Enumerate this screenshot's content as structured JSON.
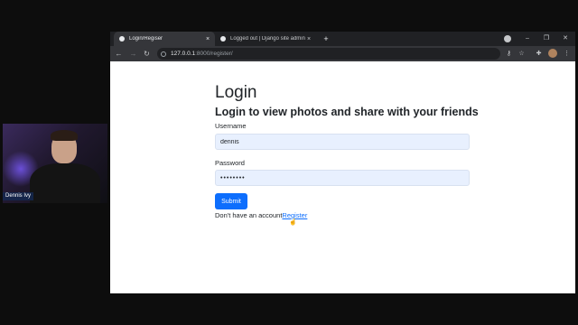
{
  "webcam": {
    "presenter_name": "Dennis Ivy"
  },
  "browser": {
    "tabs": [
      {
        "title": "Login/Regiser",
        "close": "×"
      },
      {
        "title": "Logged out | Django site admin",
        "close": "×"
      }
    ],
    "new_tab": "+",
    "window_controls": {
      "minimize": "–",
      "maximize": "❐",
      "close": "✕"
    },
    "nav": {
      "back": "←",
      "forward": "→",
      "reload": "↻"
    },
    "url": {
      "host": "127.0.0.1",
      "path": ":8000/register/"
    },
    "toolbar_icons": {
      "key": "⚷",
      "star": "☆",
      "extensions": "✚",
      "menu": "⋮"
    }
  },
  "page": {
    "title": "Login",
    "subtitle": "Login to view photos and share with your friends",
    "username_label": "Username",
    "username_value": "dennis",
    "password_label": "Password",
    "password_value": "••••••••",
    "submit_label": "Submit",
    "account_prompt": "Don't have an account",
    "register_link": "Register"
  },
  "colors": {
    "primary": "#0d6efd",
    "input_fill": "#e8f0fe",
    "chrome_dark": "#202124"
  }
}
